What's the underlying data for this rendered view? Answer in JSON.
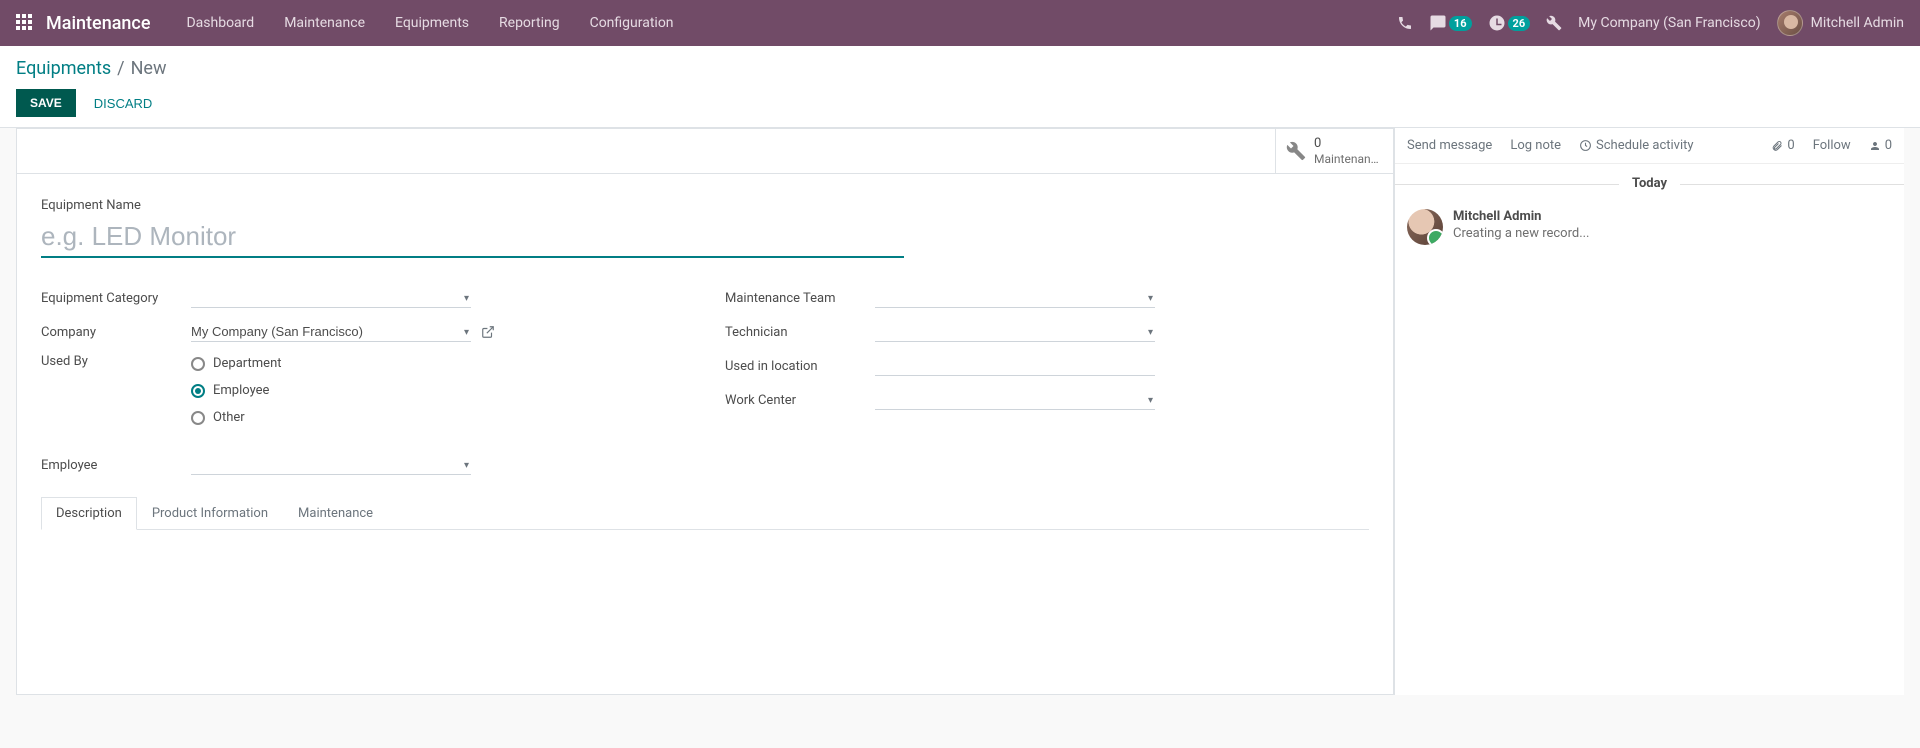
{
  "navbar": {
    "brand": "Maintenance",
    "menu": [
      "Dashboard",
      "Maintenance",
      "Equipments",
      "Reporting",
      "Configuration"
    ],
    "messages_badge": "16",
    "activities_badge": "26",
    "company": "My Company (San Francisco)",
    "user": "Mitchell Admin"
  },
  "breadcrumb": {
    "root": "Equipments",
    "current": "New"
  },
  "buttons": {
    "save": "SAVE",
    "discard": "DISCARD"
  },
  "stat": {
    "value": "0",
    "label": "Maintenan…"
  },
  "form": {
    "name_label": "Equipment Name",
    "name_placeholder": "e.g. LED Monitor",
    "category_label": "Equipment Category",
    "company_label": "Company",
    "company_value": "My Company (San Francisco)",
    "usedby_label": "Used By",
    "usedby_options": {
      "department": "Department",
      "employee": "Employee",
      "other": "Other"
    },
    "usedby_selected": "employee",
    "employee_label": "Employee",
    "team_label": "Maintenance Team",
    "technician_label": "Technician",
    "location_label": "Used in location",
    "workcenter_label": "Work Center"
  },
  "tabs": {
    "description": "Description",
    "product": "Product Information",
    "maintenance": "Maintenance"
  },
  "chatter": {
    "send": "Send message",
    "log": "Log note",
    "schedule": "Schedule activity",
    "attach_count": "0",
    "follow": "Follow",
    "followers_count": "0",
    "date": "Today",
    "message": {
      "author": "Mitchell Admin",
      "body": "Creating a new record..."
    }
  }
}
